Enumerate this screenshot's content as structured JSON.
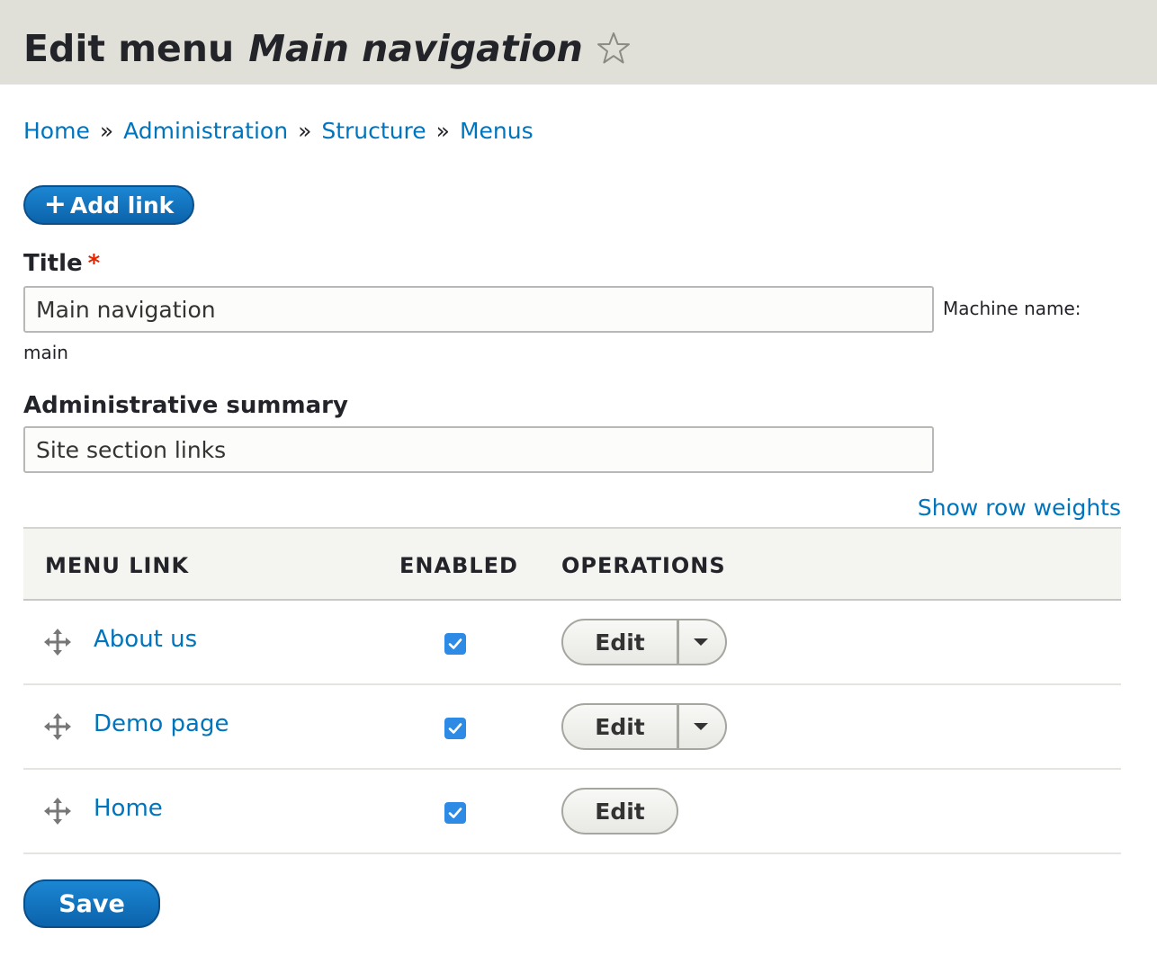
{
  "header": {
    "title_prefix": "Edit menu",
    "title_menu_name": "Main navigation"
  },
  "breadcrumb": {
    "items": [
      "Home",
      "Administration",
      "Structure",
      "Menus"
    ],
    "separator": "»"
  },
  "actions": {
    "add_link_icon": "+",
    "add_link_label": "Add link"
  },
  "form": {
    "title_label": "Title",
    "title_required_mark": "*",
    "title_value": "Main navigation",
    "machine_name_label": "Machine name:",
    "machine_name_value": "main",
    "summary_label": "Administrative summary",
    "summary_value": "Site section links",
    "show_row_weights": "Show row weights"
  },
  "table": {
    "headers": {
      "menu_link": "MENU LINK",
      "enabled": "ENABLED",
      "operations": "OPERATIONS"
    },
    "rows": [
      {
        "label": "About us",
        "enabled": true,
        "edit_label": "Edit",
        "has_dropdown": true
      },
      {
        "label": "Demo page",
        "enabled": true,
        "edit_label": "Edit",
        "has_dropdown": true
      },
      {
        "label": "Home",
        "enabled": true,
        "edit_label": "Edit",
        "has_dropdown": false
      }
    ]
  },
  "footer": {
    "save_label": "Save"
  },
  "colors": {
    "link": "#0074bd",
    "primary_button": "#0b63ab",
    "header_bg": "#e0e0d8",
    "checkbox": "#2d8ae5",
    "required": "#e62600"
  },
  "icons": {
    "favorite": "star-outline-icon",
    "drag": "move-arrows-icon",
    "check": "checkmark-icon",
    "dropdown": "chevron-down-icon"
  }
}
